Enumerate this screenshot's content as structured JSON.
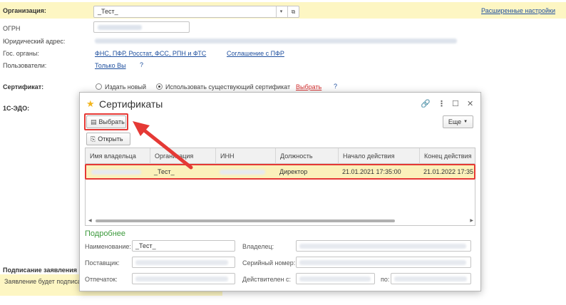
{
  "form": {
    "org_label": "Организация:",
    "org_value": "_Тест_",
    "advanced_link": "Расширенные настройки",
    "ogrn_label": "ОГРН",
    "legal_address_label": "Юридический адрес:",
    "gov_label": "Гос. органы:",
    "gov_link": "ФНС, ПФР, Росстат, ФСС, РПН и ФТС",
    "pfr_link": "Соглашение с ПФР",
    "users_label": "Пользователи:",
    "users_link": "Только Вы",
    "help": "?",
    "cert_label": "Сертификат:",
    "radio_new": "Издать новый",
    "radio_existing": "Использовать существующий сертификат",
    "choose_link": "Выбрать",
    "edo_label": "1С-ЭДО:",
    "signing_label": "Подписание заявления",
    "signing_text": "Заявление будет подписа"
  },
  "dialog": {
    "title": "Сертификаты",
    "choose_button": "Выбрать",
    "open_button": "Открыть",
    "more_button": "Еще",
    "columns": [
      "Имя владельца",
      "Организация",
      "ИНН",
      "Должность",
      "Начало действия",
      "Конец действия"
    ],
    "row": {
      "org": "_Тест_",
      "position": "Директор",
      "start": "21.01.2021 17:35:00",
      "end": "21.01.2022 17:35"
    },
    "details": {
      "title": "Подробнее",
      "name_label": "Наименование:",
      "name_value": "_Тест_",
      "owner_label": "Владелец:",
      "supplier_label": "Поставщик:",
      "serial_label": "Серийный номер:",
      "print_label": "Отпечаток:",
      "valid_from_label": "Действителен с:",
      "to_label": "по:"
    }
  },
  "colors": {
    "accent_red": "#e53935",
    "link": "#1e4f9e",
    "row_highlight": "#fbf1bb",
    "org_bar": "#fdf6c3",
    "details_green": "#3c9a3c"
  }
}
